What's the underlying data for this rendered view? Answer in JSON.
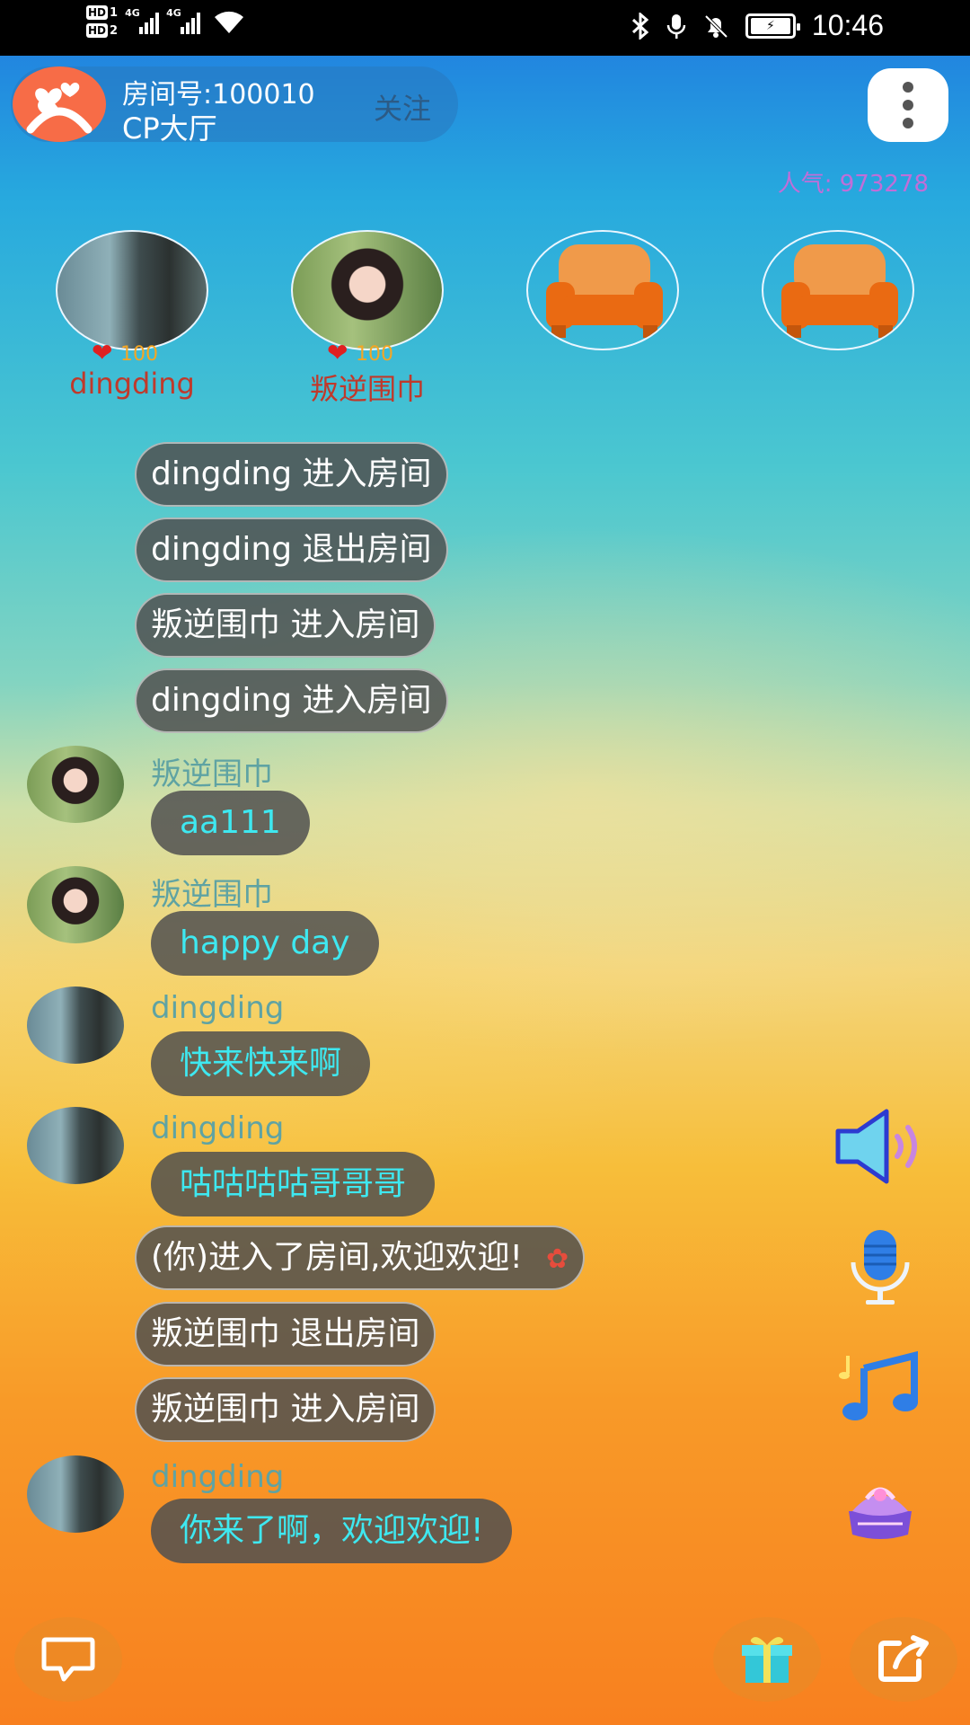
{
  "status_bar": {
    "hd1": "HD",
    "hd1_num": "1",
    "hd2": "HD",
    "hd2_num": "2",
    "net1": "4G",
    "net2": "4G",
    "time": "10:46",
    "icons": [
      "bluetooth-icon",
      "mic-icon",
      "mute-bell-icon",
      "battery-icon"
    ]
  },
  "room": {
    "id_label": "房间号:100010",
    "name": "CP大厅",
    "follow_label": "关注",
    "popularity": "人气: 973278"
  },
  "seats": [
    {
      "name": "dingding",
      "likes": "100",
      "occupied": true
    },
    {
      "name": "叛逆围巾",
      "likes": "100",
      "occupied": true
    },
    {
      "name": "",
      "likes": "",
      "occupied": false
    },
    {
      "name": "",
      "likes": "",
      "occupied": false
    }
  ],
  "messages": {
    "sys1": "dingding 进入房间",
    "sys2": "dingding 退出房间",
    "sys3": "叛逆围巾 进入房间",
    "sys4": "dingding 进入房间",
    "chat1": {
      "user": "叛逆围巾",
      "text": "aa111"
    },
    "chat2": {
      "user": "叛逆围巾",
      "text": "happy day"
    },
    "chat3": {
      "user": "dingding",
      "text": "快来快来啊"
    },
    "chat4": {
      "user": "dingding",
      "text": "咕咕咕咕哥哥哥"
    },
    "sys5": "(你)进入了房间,欢迎欢迎!",
    "sys6": "叛逆围巾 退出房间",
    "sys7": "叛逆围巾 进入房间",
    "chat5": {
      "user": "dingding",
      "text": "你来了啊，欢迎欢迎!"
    }
  },
  "colors": {
    "sys_bubble": "#505050",
    "chat_text": "#3ee8f0",
    "seat_name": "#c0392b",
    "popularity": "#c06ed8",
    "logo": "#f76c47"
  },
  "side_tools": [
    "speaker-icon",
    "microphone-icon",
    "music-icon",
    "gift-box-icon"
  ],
  "bottom_bar": [
    "chat-icon",
    "gift-icon",
    "share-icon"
  ]
}
